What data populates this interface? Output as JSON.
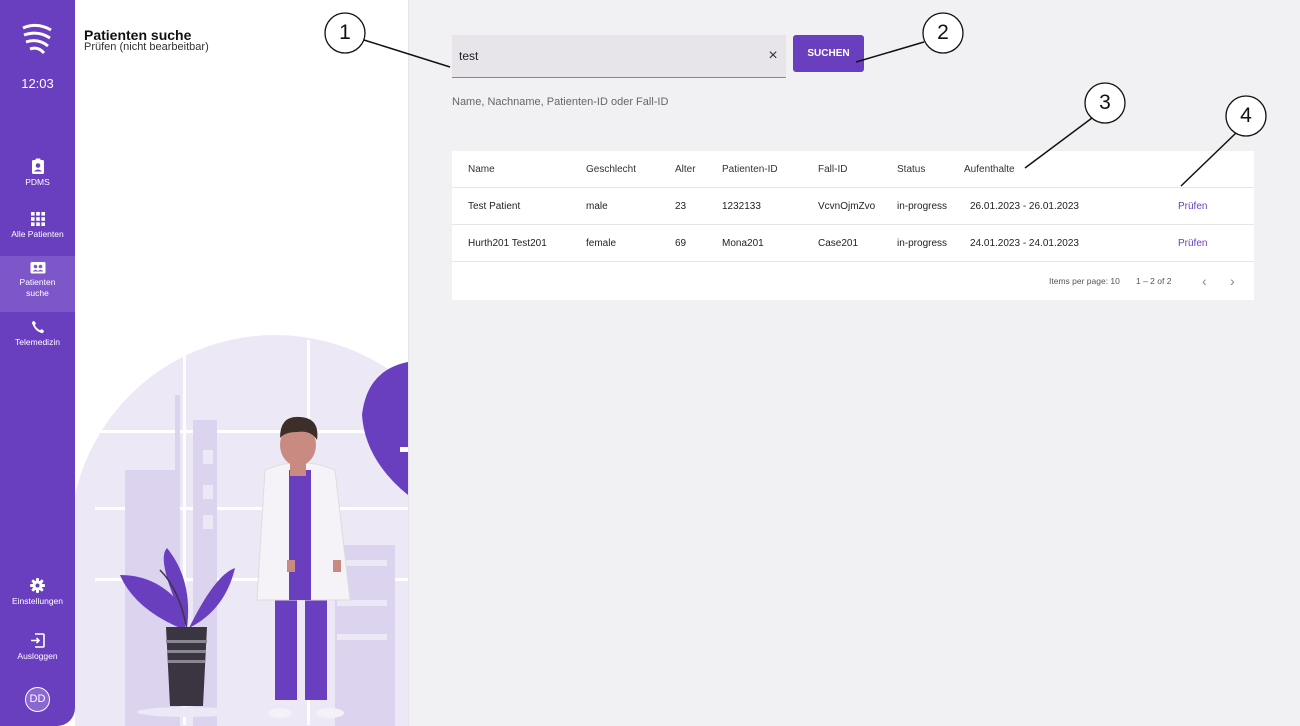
{
  "sidebar": {
    "time": "12:03",
    "items": [
      {
        "label": "PDMS",
        "icon": "clipboard-person-icon"
      },
      {
        "label": "Alle Patienten",
        "icon": "grid-icon"
      },
      {
        "label": "Patienten\nsuche",
        "icon": "person-card-icon",
        "active": true
      },
      {
        "label": "Telemedizin",
        "icon": "phone-icon"
      }
    ],
    "bottom_items": [
      {
        "label": "Einstellungen",
        "icon": "gear-icon"
      },
      {
        "label": "Ausloggen",
        "icon": "logout-icon"
      }
    ],
    "avatar_initials": "DD"
  },
  "panel": {
    "title": "Patienten suche",
    "subtitle": "Prüfen (nicht bearbeitbar)"
  },
  "search": {
    "value": "test",
    "hint": "Name, Nachname, Patienten-ID oder Fall-ID",
    "clear_label": "×",
    "button_label": "SUCHEN"
  },
  "table": {
    "columns": [
      "Name",
      "Geschlecht",
      "Alter",
      "Patienten-ID",
      "Fall-ID",
      "Status",
      "Aufenthalte"
    ],
    "rows": [
      {
        "name": "Test Patient",
        "gender": "male",
        "age": "23",
        "patient_id": "1232133",
        "case_id": "VcvnOjmZvo",
        "status": "in-progress",
        "stays": "26.01.2023 - 26.01.2023",
        "action": "Prüfen"
      },
      {
        "name": "Hurth201 Test201",
        "gender": "female",
        "age": "69",
        "patient_id": "Mona201",
        "case_id": "Case201",
        "status": "in-progress",
        "stays": "24.01.2023 - 24.01.2023",
        "action": "Prüfen"
      }
    ]
  },
  "pagination": {
    "items_per_page_label": "Items per page: 10",
    "range": "1 – 2 of 2",
    "prev": "‹",
    "next": "›"
  },
  "callouts": [
    "1",
    "2",
    "3",
    "4"
  ],
  "colors": {
    "primary": "#6a3fbf",
    "background": "#f1f0f3",
    "illustration_light": "#ede8f6"
  }
}
